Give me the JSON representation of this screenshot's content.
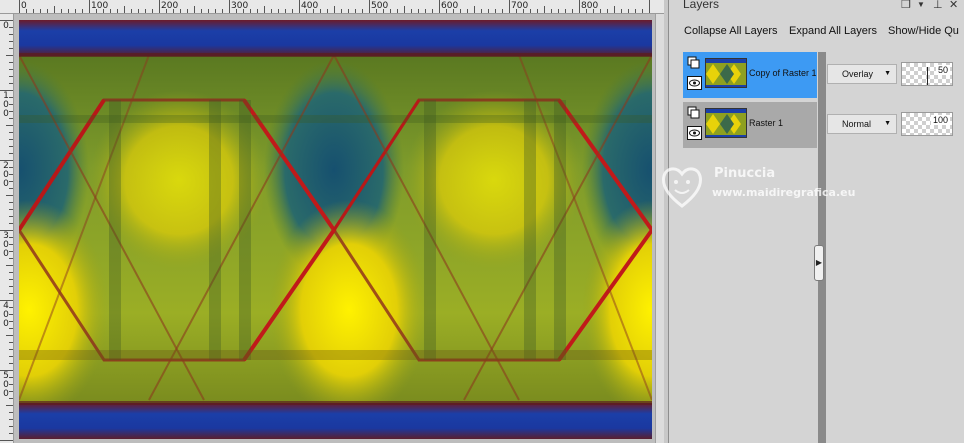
{
  "ruler": {
    "top_labels": [
      "0",
      "100",
      "200",
      "300",
      "400",
      "500",
      "600",
      "700",
      "800"
    ],
    "left_labels": [
      "0",
      "1\n0\n0",
      "2\n0\n0",
      "3\n0\n0",
      "4\n0\n0",
      "5\n0\n0"
    ]
  },
  "layers_palette": {
    "title": "Layers",
    "toolbar": {
      "collapse_all": "Collapse All Layers",
      "expand_all": "Expand All Layers",
      "show_hide": "Show/Hide Qu"
    },
    "layers": [
      {
        "name": "Copy of Raster 1",
        "blend_mode": "Overlay",
        "opacity": "50",
        "opacity_fraction": 0.5,
        "selected": true
      },
      {
        "name": "Raster 1",
        "blend_mode": "Normal",
        "opacity": "100",
        "opacity_fraction": 1.0,
        "selected": false
      }
    ]
  },
  "watermark": {
    "name": "Pinuccia",
    "url": "www.maidiregrafica.eu"
  },
  "colors": {
    "selected_row": "#3d9af3",
    "normal_row": "#a9a9a9",
    "canvas_band_blue": "#1b3fa8",
    "canvas_band_red": "#8a1a1a",
    "canvas_yellow": "#e8d20a",
    "canvas_green": "#6e8c2a",
    "canvas_teal": "#1f5e7e"
  }
}
